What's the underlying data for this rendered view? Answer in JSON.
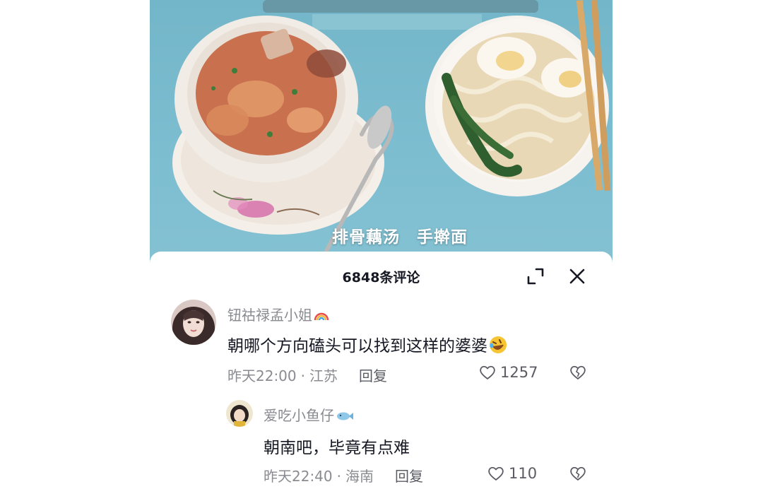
{
  "photo": {
    "caption": "排骨藕汤　手擀面"
  },
  "sheet": {
    "title": "6848条评论",
    "expand_icon": "expand-icon",
    "close_icon": "close-icon"
  },
  "comments": [
    {
      "username": "钮祜禄孟小姐",
      "badge_emoji": "rainbow",
      "text": "朝哪个方向磕头可以找到这样的婆婆",
      "text_emoji": "rolling-laughing",
      "time": "昨天22:00",
      "location": "江苏",
      "reply_label": "回复",
      "likes": "1257"
    },
    {
      "username": "爱吃小鱼仔",
      "badge_emoji": "fish",
      "text": "朝南吧，毕竟有点难",
      "time": "昨天22:40",
      "location": "海南",
      "reply_label": "回复",
      "likes": "110"
    }
  ],
  "colors": {
    "primary_text": "#161823",
    "secondary_text": "#8a8b91",
    "table_blue": "#7cbdd0"
  }
}
